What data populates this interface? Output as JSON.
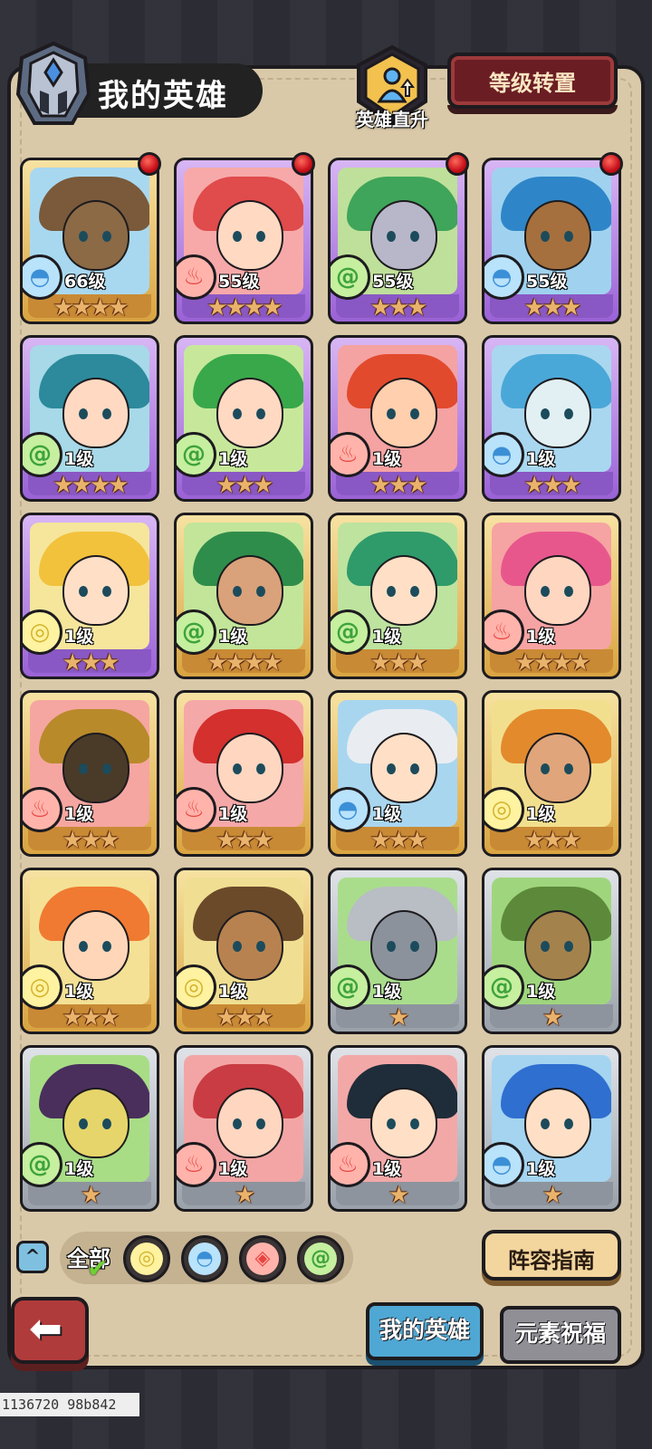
{
  "header": {
    "title": "我的英雄",
    "promote_label": "英雄直升",
    "rank_transfer_label": "等级转置"
  },
  "colors": {
    "gold_card": "#e9c36a",
    "purple_card": "#b784e6",
    "gray_card": "#b9bec4",
    "fire": "#f07b7b",
    "water": "#5aa9e0",
    "wind": "#76c94a",
    "earth": "#e3d457"
  },
  "heroes": [
    {
      "level": "66级",
      "stars": "★★★★",
      "element": "water",
      "frame": "gold",
      "notify": true,
      "hair": "#7a5a3a",
      "skin": "#8b6a45",
      "bg": "#a8d8f0"
    },
    {
      "level": "55级",
      "stars": "★★★★",
      "element": "fire",
      "frame": "purple",
      "notify": true,
      "hair": "#e04b4b",
      "skin": "#ffd9c2",
      "bg": "#f7a9a9"
    },
    {
      "level": "55级",
      "stars": "★★★",
      "element": "wind",
      "frame": "purple",
      "notify": true,
      "hair": "#3fa55a",
      "skin": "#b8b7c9",
      "bg": "#bfe09a"
    },
    {
      "level": "55级",
      "stars": "★★★",
      "element": "water",
      "frame": "purple",
      "notify": true,
      "hair": "#2e86c8",
      "skin": "#a5703d",
      "bg": "#a0d2ef"
    },
    {
      "level": "1级",
      "stars": "★★★★",
      "element": "wind",
      "frame": "purple",
      "notify": false,
      "hair": "#2c8a9c",
      "skin": "#ffd9c2",
      "bg": "#a7d9e8"
    },
    {
      "level": "1级",
      "stars": "★★★",
      "element": "wind",
      "frame": "purple",
      "notify": false,
      "hair": "#39a84a",
      "skin": "#ffd9c2",
      "bg": "#c7e89b"
    },
    {
      "level": "1级",
      "stars": "★★★",
      "element": "fire",
      "frame": "purple",
      "notify": false,
      "hair": "#e24a2d",
      "skin": "#ffcfae",
      "bg": "#f5a2a2"
    },
    {
      "level": "1级",
      "stars": "★★★",
      "element": "water",
      "frame": "purple",
      "notify": false,
      "hair": "#4aa8d8",
      "skin": "#e2f0f3",
      "bg": "#a9d7ef"
    },
    {
      "level": "1级",
      "stars": "★★★",
      "element": "earth",
      "frame": "purple",
      "notify": false,
      "hair": "#f2c23c",
      "skin": "#ffe0c6",
      "bg": "#f5e69c"
    },
    {
      "level": "1级",
      "stars": "★★★★",
      "element": "wind",
      "frame": "gold",
      "notify": false,
      "hair": "#2f8d4b",
      "skin": "#d9a27a",
      "bg": "#c2e59a"
    },
    {
      "level": "1级",
      "stars": "★★★",
      "element": "wind",
      "frame": "gold",
      "notify": false,
      "hair": "#2f9a6a",
      "skin": "#ffe0c6",
      "bg": "#bde39f"
    },
    {
      "level": "1级",
      "stars": "★★★★",
      "element": "fire",
      "frame": "gold",
      "notify": false,
      "hair": "#e8578c",
      "skin": "#ffd6c0",
      "bg": "#f6a3a3"
    },
    {
      "level": "1级",
      "stars": "★★★",
      "element": "fire",
      "frame": "gold",
      "notify": false,
      "hair": "#b88a2a",
      "skin": "#4a3a28",
      "bg": "#f5a6a0"
    },
    {
      "level": "1级",
      "stars": "★★★",
      "element": "fire",
      "frame": "gold",
      "notify": false,
      "hair": "#d3302e",
      "skin": "#ffd6c0",
      "bg": "#f5a8a8"
    },
    {
      "level": "1级",
      "stars": "★★★",
      "element": "water",
      "frame": "gold",
      "notify": false,
      "hair": "#e9edf1",
      "skin": "#ffe0c6",
      "bg": "#a9d6ef"
    },
    {
      "level": "1级",
      "stars": "★★★",
      "element": "earth",
      "frame": "gold",
      "notify": false,
      "hair": "#e38a2c",
      "skin": "#e0a57a",
      "bg": "#f2df8e"
    },
    {
      "level": "1级",
      "stars": "★★★",
      "element": "earth",
      "frame": "gold",
      "notify": false,
      "hair": "#f07a32",
      "skin": "#ffd6b8",
      "bg": "#f4e195"
    },
    {
      "level": "1级",
      "stars": "★★★",
      "element": "earth",
      "frame": "gold",
      "notify": false,
      "hair": "#6b4a2a",
      "skin": "#b7824f",
      "bg": "#f0df92"
    },
    {
      "level": "1级",
      "stars": "★",
      "element": "wind",
      "frame": "gray",
      "notify": false,
      "hair": "#b9bdc4",
      "skin": "#8c929b",
      "bg": "#a9dd8c"
    },
    {
      "level": "1级",
      "stars": "★",
      "element": "wind",
      "frame": "gray",
      "notify": false,
      "hair": "#5d8a3a",
      "skin": "#a4824c",
      "bg": "#9fd67d"
    },
    {
      "level": "1级",
      "stars": "★",
      "element": "wind",
      "frame": "gray",
      "notify": false,
      "hair": "#4a2f5c",
      "skin": "#e6d56a",
      "bg": "#a8dd86"
    },
    {
      "level": "1级",
      "stars": "★",
      "element": "fire",
      "frame": "gray",
      "notify": false,
      "hair": "#c93c43",
      "skin": "#ffd6c0",
      "bg": "#f3a5a5"
    },
    {
      "level": "1级",
      "stars": "★",
      "element": "fire",
      "frame": "gray",
      "notify": false,
      "hair": "#1f2d3a",
      "skin": "#ffe0c6",
      "bg": "#f3a8a8"
    },
    {
      "level": "1级",
      "stars": "★",
      "element": "water",
      "frame": "gray",
      "notify": false,
      "hair": "#2f6fd0",
      "skin": "#ffe0c6",
      "bg": "#a4d4f0"
    }
  ],
  "filters": {
    "all_label": "全部",
    "items": [
      {
        "element": "earth",
        "glyph": "◎"
      },
      {
        "element": "water",
        "glyph": "◓"
      },
      {
        "element": "fire",
        "glyph": "◈"
      },
      {
        "element": "wind",
        "glyph": "@"
      }
    ]
  },
  "buttons": {
    "lineup_guide": "阵容指南",
    "back": "⬅"
  },
  "tabs": [
    {
      "label": "我的英雄",
      "active": true
    },
    {
      "label": "元素祝福",
      "active": false
    }
  ],
  "debug_text": "1136720 98b842"
}
